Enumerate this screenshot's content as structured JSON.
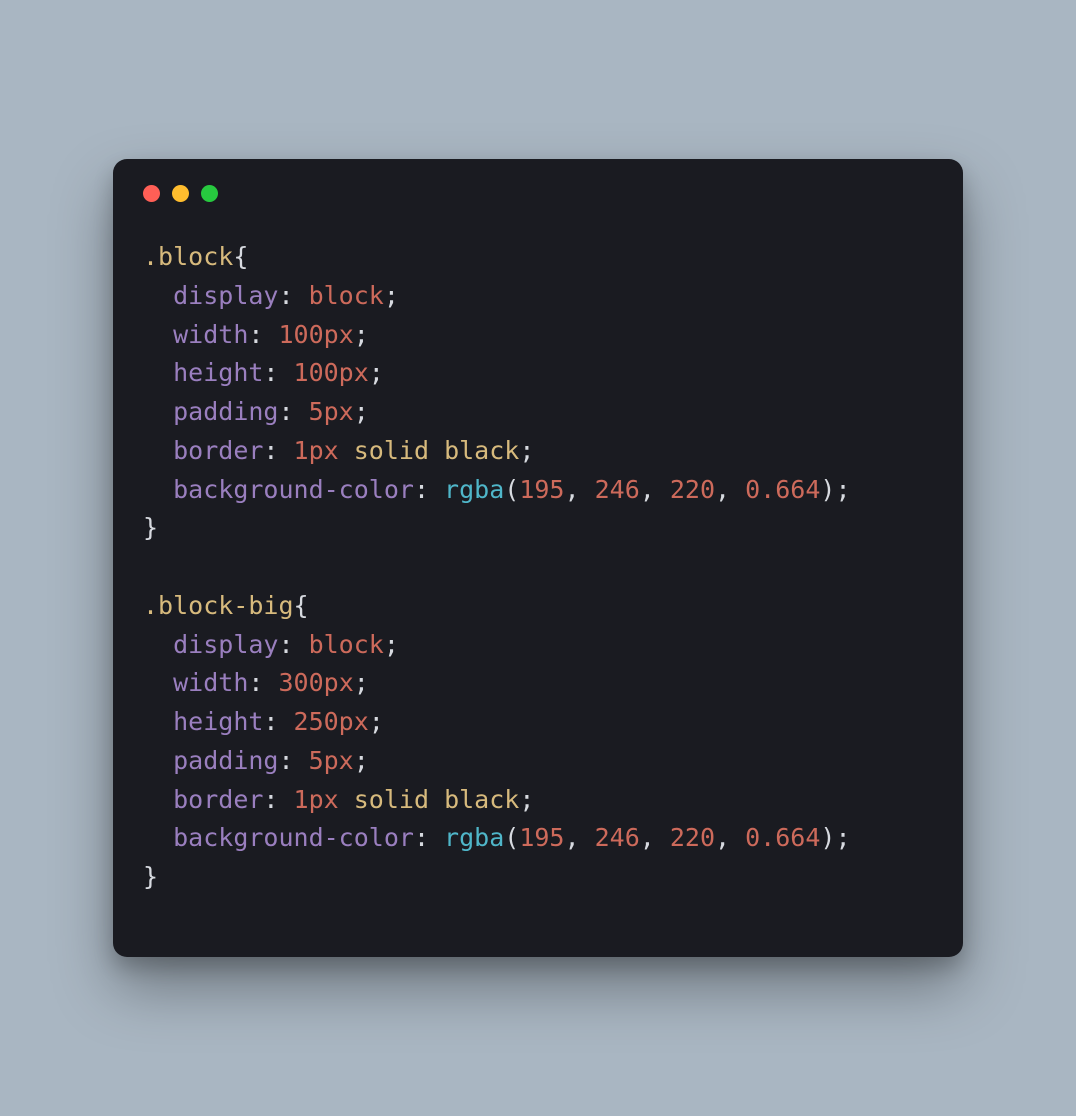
{
  "window": {
    "traffic_lights": [
      "close",
      "minimize",
      "zoom"
    ]
  },
  "code": {
    "rules": [
      {
        "selector": ".block",
        "declarations": [
          {
            "prop": "display",
            "value": [
              {
                "t": "val",
                "s": "block"
              }
            ]
          },
          {
            "prop": "width",
            "value": [
              {
                "t": "val",
                "s": "100px"
              }
            ]
          },
          {
            "prop": "height",
            "value": [
              {
                "t": "val",
                "s": "100px"
              }
            ]
          },
          {
            "prop": "padding",
            "value": [
              {
                "t": "val",
                "s": "5px"
              }
            ]
          },
          {
            "prop": "border",
            "value": [
              {
                "t": "val",
                "s": "1px"
              },
              {
                "t": "sp"
              },
              {
                "t": "ident",
                "s": "solid"
              },
              {
                "t": "sp"
              },
              {
                "t": "ident",
                "s": "black"
              }
            ]
          },
          {
            "prop": "background-color",
            "value": [
              {
                "t": "func",
                "s": "rgba"
              },
              {
                "t": "paren",
                "s": "("
              },
              {
                "t": "num",
                "s": "195"
              },
              {
                "t": "comma",
                "s": ", "
              },
              {
                "t": "num",
                "s": "246"
              },
              {
                "t": "comma",
                "s": ", "
              },
              {
                "t": "num",
                "s": "220"
              },
              {
                "t": "comma",
                "s": ", "
              },
              {
                "t": "num",
                "s": "0.664"
              },
              {
                "t": "paren",
                "s": ")"
              }
            ]
          }
        ]
      },
      {
        "selector": ".block-big",
        "declarations": [
          {
            "prop": "display",
            "value": [
              {
                "t": "val",
                "s": "block"
              }
            ]
          },
          {
            "prop": "width",
            "value": [
              {
                "t": "val",
                "s": "300px"
              }
            ]
          },
          {
            "prop": "height",
            "value": [
              {
                "t": "val",
                "s": "250px"
              }
            ]
          },
          {
            "prop": "padding",
            "value": [
              {
                "t": "val",
                "s": "5px"
              }
            ]
          },
          {
            "prop": "border",
            "value": [
              {
                "t": "val",
                "s": "1px"
              },
              {
                "t": "sp"
              },
              {
                "t": "ident",
                "s": "solid"
              },
              {
                "t": "sp"
              },
              {
                "t": "ident",
                "s": "black"
              }
            ]
          },
          {
            "prop": "background-color",
            "value": [
              {
                "t": "func",
                "s": "rgba"
              },
              {
                "t": "paren",
                "s": "("
              },
              {
                "t": "num",
                "s": "195"
              },
              {
                "t": "comma",
                "s": ", "
              },
              {
                "t": "num",
                "s": "246"
              },
              {
                "t": "comma",
                "s": ", "
              },
              {
                "t": "num",
                "s": "220"
              },
              {
                "t": "comma",
                "s": ", "
              },
              {
                "t": "num",
                "s": "0.664"
              },
              {
                "t": "paren",
                "s": ")"
              }
            ]
          }
        ]
      }
    ]
  }
}
